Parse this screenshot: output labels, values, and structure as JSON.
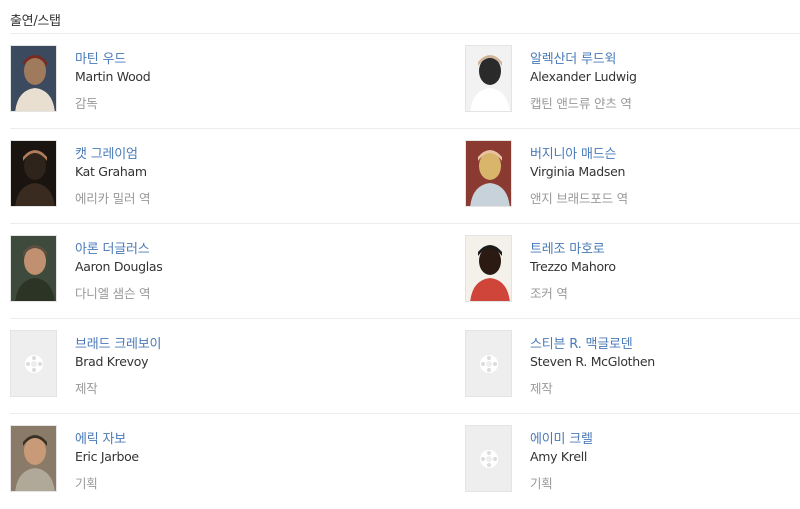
{
  "section": {
    "title": "출연/스탭"
  },
  "rows": [
    [
      {
        "kname": "마틴 우드",
        "ename": "Martin Wood",
        "role": "감독",
        "photo": true,
        "palette": [
          "#3b4a5e",
          "#a07a5c",
          "#7a2a20",
          "#e8dfd0"
        ]
      },
      {
        "kname": "알렉산더 루드윅",
        "ename": "Alexander Ludwig",
        "role": "캡틴 앤드류 얀츠 역",
        "photo": true,
        "palette": [
          "#f2f2f2",
          "#2a2a2a",
          "#cfb49a",
          "#ffffff"
        ]
      }
    ],
    [
      {
        "kname": "캣 그레이엄",
        "ename": "Kat Graham",
        "role": "에리카 밀러 역",
        "photo": true,
        "palette": [
          "#1a1410",
          "#2e241c",
          "#b07c5a",
          "#3a2b20"
        ]
      },
      {
        "kname": "버지니아 매드슨",
        "ename": "Virginia Madsen",
        "role": "앤지 브래드포드 역",
        "photo": true,
        "palette": [
          "#8a3a30",
          "#d8b56a",
          "#e8c4a4",
          "#c8d2da"
        ]
      }
    ],
    [
      {
        "kname": "아론 더글러스",
        "ename": "Aaron Douglas",
        "role": "다니엘 샘슨 역",
        "photo": true,
        "palette": [
          "#3e4a3c",
          "#c09070",
          "#5b5040",
          "#2c3426"
        ]
      },
      {
        "kname": "트레조 마호로",
        "ename": "Trezzo Mahoro",
        "role": "조커 역",
        "photo": true,
        "palette": [
          "#f4f0ea",
          "#2a1a12",
          "#1a1a1a",
          "#d0453a"
        ]
      }
    ],
    [
      {
        "kname": "브래드 크레보이",
        "ename": "Brad Krevoy",
        "role": "제작",
        "photo": false
      },
      {
        "kname": "스티븐 R. 맥글로덴",
        "ename": "Steven R. McGlothen",
        "role": "제작",
        "photo": false
      }
    ],
    [
      {
        "kname": "에릭 자보",
        "ename": "Eric Jarboe",
        "role": "기획",
        "photo": true,
        "palette": [
          "#8a7a68",
          "#c89a78",
          "#3a3026",
          "#b0a898"
        ]
      },
      {
        "kname": "에이미 크렐",
        "ename": "Amy Krell",
        "role": "기획",
        "photo": false
      }
    ]
  ]
}
